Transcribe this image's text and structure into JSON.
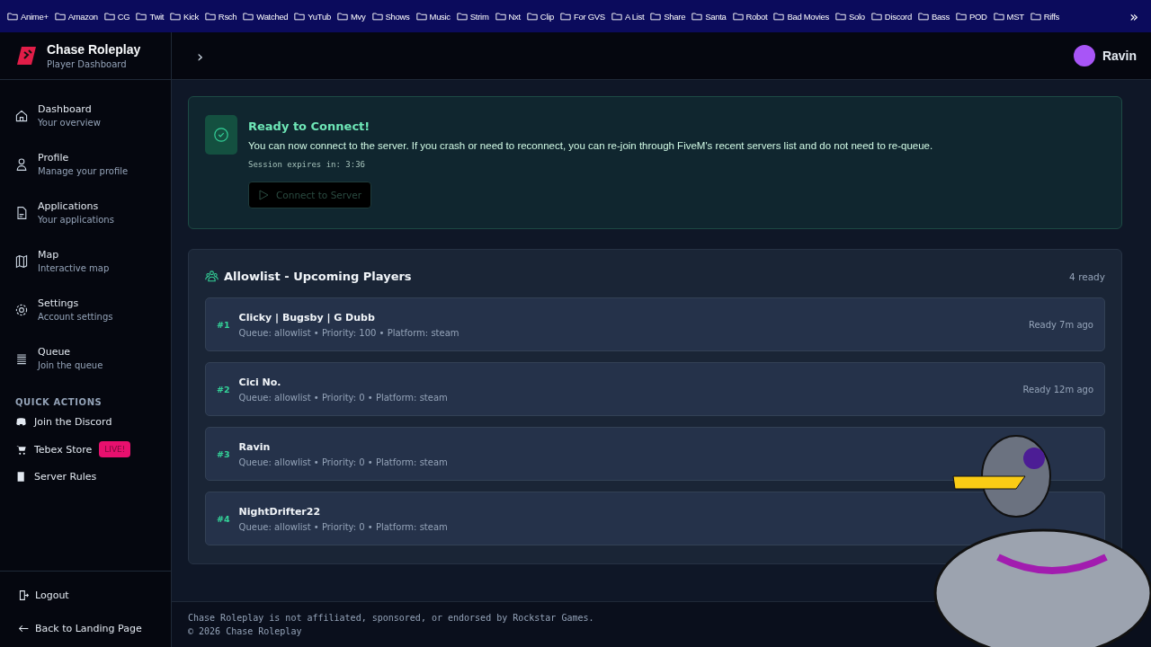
{
  "bookmarks": [
    "Anime+",
    "Amazon",
    "CG",
    "Twit",
    "Kick",
    "Rsch",
    "Watched",
    "YuTub",
    "Mvy",
    "Shows",
    "Music",
    "Strim",
    "Nxt",
    "Clip",
    "For GVS",
    "A List",
    "Share",
    "Santa",
    "Robot",
    "Bad Movies",
    "Solo",
    "Discord",
    "Bass",
    "POD",
    "MST",
    "Riffs"
  ],
  "bookmarks_overflow": "»",
  "brand": {
    "title": "Chase Roleplay",
    "subtitle": "Player Dashboard"
  },
  "header": {
    "expand_glyph": "›",
    "user": "Ravin"
  },
  "sidebar": {
    "items": [
      {
        "label": "Dashboard",
        "sub": "Your overview"
      },
      {
        "label": "Profile",
        "sub": "Manage your profile"
      },
      {
        "label": "Applications",
        "sub": "Your applications"
      },
      {
        "label": "Map",
        "sub": "Interactive map"
      },
      {
        "label": "Settings",
        "sub": "Account settings"
      },
      {
        "label": "Queue",
        "sub": "Join the queue"
      }
    ],
    "quick_actions_title": "QUICK ACTIONS",
    "quick_actions": [
      {
        "label": "Join the Discord"
      },
      {
        "label": "Tebex Store",
        "badge": "LIVE!"
      },
      {
        "label": "Server Rules"
      }
    ],
    "logout": "Logout",
    "back": "Back to Landing Page"
  },
  "connect_card": {
    "title": "Ready to Connect!",
    "message": "You can now connect to the server. If you crash or need to reconnect, you can re-join through FiveM's recent servers list and do not need to re-queue.",
    "session": "Session expires in: 3:36",
    "button": {
      "label": "Connect to Server",
      "disabled": true
    }
  },
  "allowlist": {
    "title": "Allowlist - Upcoming Players",
    "count": "4 ready",
    "players": [
      {
        "rank": "#1",
        "name": "Clicky | Bugsby | G Dubb",
        "details": "Queue: allowlist • Priority: 100 • Platform: steam",
        "ready": "Ready 7m ago"
      },
      {
        "rank": "#2",
        "name": "Cici No.",
        "details": "Queue: allowlist • Priority: 0 • Platform: steam",
        "ready": "Ready 12m ago"
      },
      {
        "rank": "#3",
        "name": "Ravin",
        "details": "Queue: allowlist • Priority: 0 • Platform: steam"
      },
      {
        "rank": "#4",
        "name": "NightDrifter22",
        "details": "Queue: allowlist • Priority: 0 • Platform: steam"
      }
    ]
  },
  "footer": {
    "disclaimer": "Chase Roleplay is not affiliated, sponsored, or endorsed by Rockstar Games.",
    "copyright": "© 2026 Chase Roleplay"
  }
}
